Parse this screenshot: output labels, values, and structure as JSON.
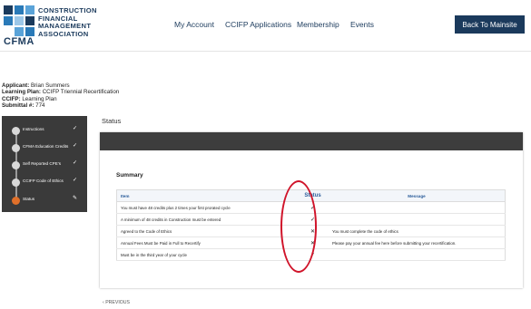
{
  "header": {
    "logo_lines": [
      "CONSTRUCTION",
      "FINANCIAL",
      "MANAGEMENT",
      "ASSOCIATION"
    ],
    "logo_abbr": "CFMA",
    "logo_colors": [
      "#1b3a5c",
      "#2a7ab8",
      "#5aa3d8",
      "#9cc7e8"
    ],
    "nav": [
      "My Account",
      "CCIFP Applications",
      "Membership",
      "Events"
    ],
    "back_button": "Back To Mainsite"
  },
  "applicant": {
    "applicant_label": "Applicant:",
    "applicant_value": "Brian Summers",
    "plan_label": "Learning Plan:",
    "plan_value": "CCIFP Triennial Recertification",
    "ccifp_label": "CCIFP:",
    "ccifp_value": "Learning Plan",
    "submittal_label": "Submittal #:",
    "submittal_value": "774"
  },
  "steps": [
    {
      "label": "Instructions",
      "check": "✓",
      "active": false
    },
    {
      "label": "CFMA Education Credits",
      "check": "✓",
      "active": false
    },
    {
      "label": "Self Reported CPE's",
      "check": "✓",
      "active": false
    },
    {
      "label": "CCIFP Code of Ethics",
      "check": "✓",
      "active": false
    },
    {
      "label": "Status",
      "check": "✎",
      "active": true
    }
  ],
  "main": {
    "title": "Status",
    "summary_title": "Summary",
    "columns": [
      "Item",
      "Status",
      "Message"
    ],
    "rows": [
      {
        "item": "You must have 48 credits plus 2 times your first prorated cycle",
        "status": "✓",
        "message": ""
      },
      {
        "item": "A minimum of 48 credits in Construction must be entered",
        "status": "✓",
        "message": ""
      },
      {
        "item": "Agreed to the Code of Ethics",
        "status": "✕",
        "message": "You must complete the code of ethics"
      },
      {
        "item": "Annual Fees Must be Paid in Full to Recertify",
        "status": "✕",
        "message": "Please pay your annual fee here before submitting your recertification."
      },
      {
        "item": "Must be in the third year of your cycle",
        "status": "✓",
        "message": ""
      }
    ],
    "previous": "PREVIOUS"
  },
  "accent_colors": {
    "brand": "#1b3a5c",
    "active_step": "#e0702a",
    "highlight": "#d0142a"
  }
}
